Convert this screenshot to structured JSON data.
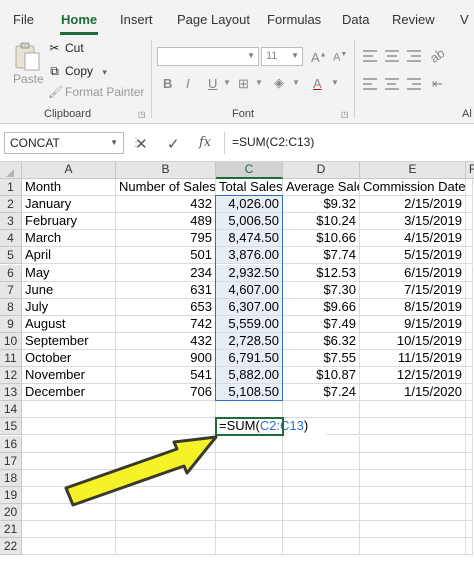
{
  "ribbon_tabs": [
    "File",
    "Home",
    "Insert",
    "Page Layout",
    "Formulas",
    "Data",
    "Review",
    "V"
  ],
  "active_tab": "Home",
  "clipboard": {
    "paste": "Paste",
    "cut": "Cut",
    "copy": "Copy",
    "copy_arrow": "▾",
    "format_painter": "Format Painter",
    "group_label": "Clipboard"
  },
  "font_group": {
    "font_size": "11",
    "group_label": "Font",
    "bold": "B",
    "italic": "I",
    "underline": "U"
  },
  "alignment_group": {
    "group_label": "Al"
  },
  "formula_bar": {
    "name_box": "CONCAT",
    "cancel": "✕",
    "enter": "✓",
    "fx": "fx",
    "formula": "=SUM(C2:C13)"
  },
  "columns": [
    "A",
    "B",
    "C",
    "D",
    "E",
    "F"
  ],
  "selected_column": "C",
  "headers": [
    "Month",
    "Number of Sales",
    "Total Sales",
    "Average Sale",
    "Commission Date"
  ],
  "rows": [
    [
      "January",
      "432",
      "4,026.00",
      "$9.32",
      "2/15/2019"
    ],
    [
      "February",
      "489",
      "5,006.50",
      "$10.24",
      "3/15/2019"
    ],
    [
      "March",
      "795",
      "8,474.50",
      "$10.66",
      "4/15/2019"
    ],
    [
      "April",
      "501",
      "3,876.00",
      "$7.74",
      "5/15/2019"
    ],
    [
      "May",
      "234",
      "2,932.50",
      "$12.53",
      "6/15/2019"
    ],
    [
      "June",
      "631",
      "4,607.00",
      "$7.30",
      "7/15/2019"
    ],
    [
      "July",
      "653",
      "6,307.00",
      "$9.66",
      "8/15/2019"
    ],
    [
      "August",
      "742",
      "5,559.00",
      "$7.49",
      "9/15/2019"
    ],
    [
      "September",
      "432",
      "2,728.50",
      "$6.32",
      "10/15/2019"
    ],
    [
      "October",
      "900",
      "6,791.50",
      "$7.55",
      "11/15/2019"
    ],
    [
      "November",
      "541",
      "5,882.00",
      "$10.87",
      "12/15/2019"
    ],
    [
      "December",
      "706",
      "5,108.50",
      "$7.24",
      "1/15/2020"
    ]
  ],
  "row_numbers": [
    "1",
    "2",
    "3",
    "4",
    "5",
    "6",
    "7",
    "8",
    "9",
    "10",
    "11",
    "12",
    "13",
    "14",
    "15",
    "16",
    "17",
    "18",
    "19",
    "20",
    "21",
    "22"
  ],
  "editing_cell": {
    "address": "C15",
    "prefix": "=SUM(",
    "range_ref": "C2:C13",
    "suffix": ")"
  },
  "colors": {
    "accent_green": "#1e6c3a",
    "range_blue": "#2f6fc4",
    "arrow_fill": "#f5f227",
    "arrow_stroke": "#3a3a2a"
  },
  "annotation": {
    "icon": "yellow-arrow-icon"
  }
}
